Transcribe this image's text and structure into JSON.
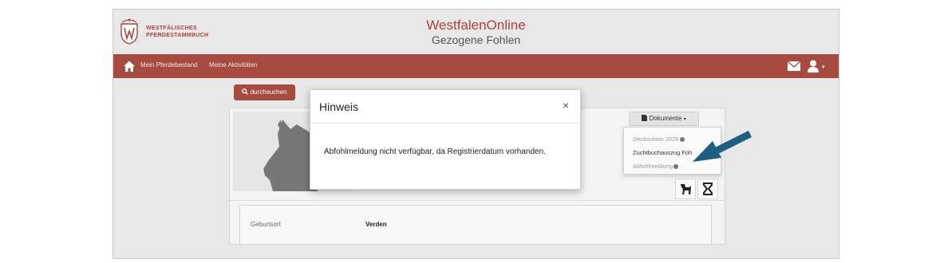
{
  "brand": {
    "logo_line1": "WESTFÄLISCHES",
    "logo_line2": "PFERDESTAMMBUCH",
    "app_title": "WestfalenOnline",
    "app_subtitle": "Gezogene Fohlen",
    "accent": "#a74a3f"
  },
  "nav": {
    "items": [
      {
        "label": "Mein Pferdebestand"
      },
      {
        "label": "Meine Aktivitäten"
      }
    ],
    "icons": [
      "home-icon",
      "mail-icon",
      "user-icon"
    ]
  },
  "search_button": {
    "label": "durchsuchen"
  },
  "documents": {
    "button_label": "Dokumente",
    "items": [
      {
        "label": "Deckschein 2026",
        "disabled": true
      },
      {
        "label": "Zuchtbuchauszug Foh",
        "disabled": false
      },
      {
        "label": "Abfohlmeldung",
        "disabled": true
      }
    ]
  },
  "details": {
    "birthplace_label": "Geburtsort",
    "birthplace_value": "Verden"
  },
  "modal": {
    "title": "Hinweis",
    "close": "×",
    "message": "Abfohlmeldung nicht verfügbar, da Registrierdatum vorhanden."
  },
  "colors": {
    "arrow": "#1d5f82",
    "navbar": "#a74a3f"
  }
}
